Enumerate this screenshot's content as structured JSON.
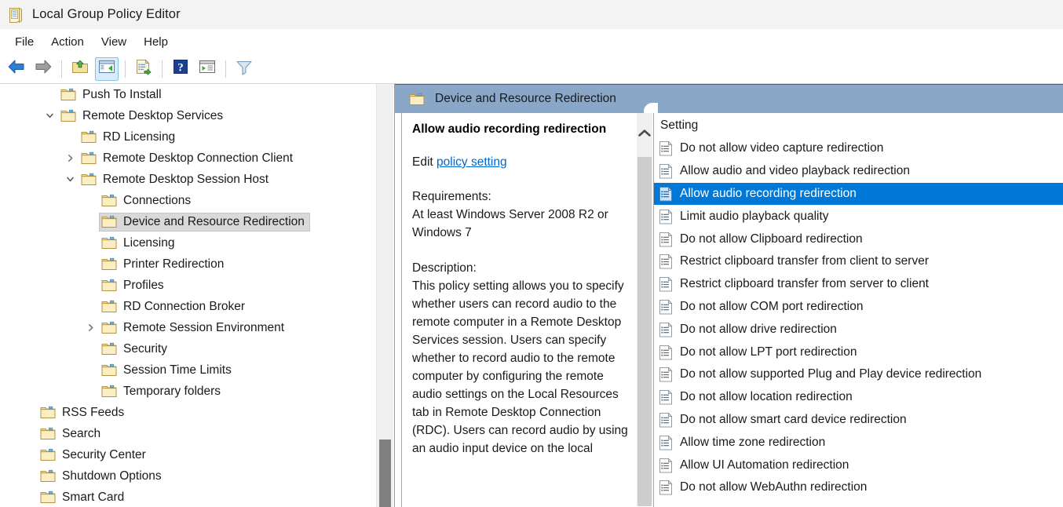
{
  "window": {
    "title": "Local Group Policy Editor",
    "icon": "policy-document-icon"
  },
  "menubar": {
    "items": [
      {
        "label": "File"
      },
      {
        "label": "Action"
      },
      {
        "label": "View"
      },
      {
        "label": "Help"
      }
    ]
  },
  "toolbar": {
    "buttons": [
      {
        "name": "back-button",
        "icon": "back-arrow-icon",
        "tooltip": "Back"
      },
      {
        "name": "forward-button",
        "icon": "forward-arrow-icon",
        "tooltip": "Forward"
      },
      {
        "name": "up-one-level-button",
        "icon": "up-folder-icon",
        "tooltip": "Up one level"
      },
      {
        "name": "show-hide-tree-button",
        "icon": "show-hide-console-tree-icon",
        "tooltip": "Show/Hide Console Tree",
        "active": true
      },
      {
        "name": "export-list-button",
        "icon": "export-list-icon",
        "tooltip": "Export List"
      },
      {
        "name": "help-button",
        "icon": "help-question-icon",
        "tooltip": "Help"
      },
      {
        "name": "view-button",
        "icon": "view-pane-icon",
        "tooltip": "View"
      },
      {
        "name": "filter-button",
        "icon": "filter-funnel-icon",
        "tooltip": "Filter"
      }
    ]
  },
  "tree": {
    "items": [
      {
        "label": "Push To Install",
        "indent": 2,
        "twisty": "none",
        "selected": false
      },
      {
        "label": "Remote Desktop Services",
        "indent": 2,
        "twisty": "expanded",
        "selected": false
      },
      {
        "label": "RD Licensing",
        "indent": 3,
        "twisty": "none",
        "selected": false
      },
      {
        "label": "Remote Desktop Connection Client",
        "indent": 3,
        "twisty": "collapsed",
        "selected": false
      },
      {
        "label": "Remote Desktop Session Host",
        "indent": 3,
        "twisty": "expanded",
        "selected": false
      },
      {
        "label": "Connections",
        "indent": 4,
        "twisty": "none",
        "selected": false
      },
      {
        "label": "Device and Resource Redirection",
        "indent": 4,
        "twisty": "none",
        "selected": true
      },
      {
        "label": "Licensing",
        "indent": 4,
        "twisty": "none",
        "selected": false
      },
      {
        "label": "Printer Redirection",
        "indent": 4,
        "twisty": "none",
        "selected": false
      },
      {
        "label": "Profiles",
        "indent": 4,
        "twisty": "none",
        "selected": false
      },
      {
        "label": "RD Connection Broker",
        "indent": 4,
        "twisty": "none",
        "selected": false
      },
      {
        "label": "Remote Session Environment",
        "indent": 4,
        "twisty": "collapsed",
        "selected": false
      },
      {
        "label": "Security",
        "indent": 4,
        "twisty": "none",
        "selected": false
      },
      {
        "label": "Session Time Limits",
        "indent": 4,
        "twisty": "none",
        "selected": false
      },
      {
        "label": "Temporary folders",
        "indent": 4,
        "twisty": "none",
        "selected": false
      },
      {
        "label": "RSS Feeds",
        "indent": 1,
        "twisty": "none",
        "selected": false
      },
      {
        "label": "Search",
        "indent": 1,
        "twisty": "none",
        "selected": false
      },
      {
        "label": "Security Center",
        "indent": 1,
        "twisty": "none",
        "selected": false
      },
      {
        "label": "Shutdown Options",
        "indent": 1,
        "twisty": "none",
        "selected": false
      },
      {
        "label": "Smart Card",
        "indent": 1,
        "twisty": "none",
        "selected": false
      }
    ]
  },
  "tab": {
    "label": "Device and Resource Redirection",
    "icon": "folder-icon"
  },
  "details": {
    "policy_title": "Allow audio recording redirection",
    "edit_prefix": "Edit ",
    "edit_link": "policy setting",
    "requirements_label": "Requirements:",
    "requirements_value": "At least Windows Server 2008 R2 or Windows 7",
    "description_label": "Description:",
    "description_value": "This policy setting allows you to specify whether users can record audio to the remote computer in a Remote Desktop Services session. Users can specify whether to record audio to the remote computer by configuring the remote audio settings on the Local Resources tab in Remote Desktop Connection (RDC). Users can record audio by using an audio input device on the local"
  },
  "list": {
    "column_header": "Setting",
    "rows": [
      {
        "label": "Do not allow video capture redirection",
        "selected": false
      },
      {
        "label": "Allow audio and video playback redirection",
        "selected": false
      },
      {
        "label": "Allow audio recording redirection",
        "selected": true
      },
      {
        "label": "Limit audio playback quality",
        "selected": false
      },
      {
        "label": "Do not allow Clipboard redirection",
        "selected": false
      },
      {
        "label": "Restrict clipboard transfer from client to server",
        "selected": false
      },
      {
        "label": "Restrict clipboard transfer from server to client",
        "selected": false
      },
      {
        "label": "Do not allow COM port redirection",
        "selected": false
      },
      {
        "label": "Do not allow drive redirection",
        "selected": false
      },
      {
        "label": "Do not allow LPT port redirection",
        "selected": false
      },
      {
        "label": "Do not allow supported Plug and Play device redirection",
        "selected": false
      },
      {
        "label": "Do not allow location redirection",
        "selected": false
      },
      {
        "label": "Do not allow smart card device redirection",
        "selected": false
      },
      {
        "label": "Allow time zone redirection",
        "selected": false
      },
      {
        "label": "Allow UI Automation redirection",
        "selected": false
      },
      {
        "label": "Do not allow WebAuthn redirection",
        "selected": false
      }
    ]
  },
  "colors": {
    "selection_blue": "#0078d7",
    "tab_band": "#8ba7c7",
    "tree_selection_gray": "#d9d9d9",
    "link_blue": "#0066cc",
    "titlebar_bg": "#f3f3f3"
  }
}
